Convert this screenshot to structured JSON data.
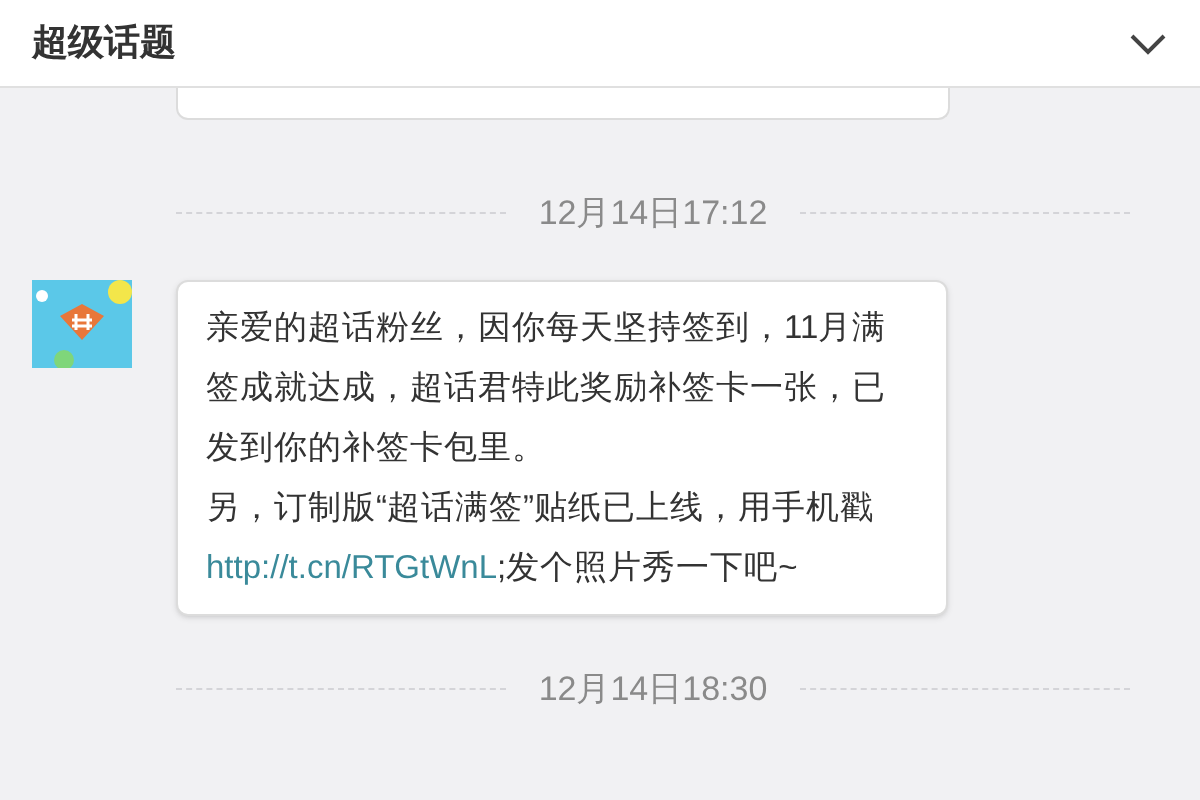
{
  "header": {
    "title": "超级话题"
  },
  "messages": [
    {
      "timestamp": "12月14日17:12",
      "paragraphs": [
        {
          "text": "亲爱的超话粉丝，因你每天坚持签到，11月满签成就达成，超话君特此奖励补签卡一张，已发到你的补签卡包里。"
        },
        {
          "text": "另，订制版“超话满签”贴纸已上线，用手机戳 ",
          "link": "http://t.cn/RTGtWnL",
          "after": ";发个照片秀一下吧~"
        }
      ]
    }
  ],
  "last_timestamp": "12月14日18:30"
}
